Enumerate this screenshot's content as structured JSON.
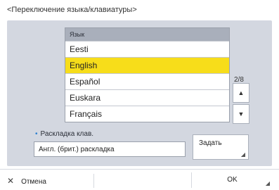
{
  "title": "<Переключение языка/клавиатуры>",
  "language_list": {
    "header": "Язык",
    "items": [
      {
        "label": "Eesti",
        "selected": false
      },
      {
        "label": "English",
        "selected": true
      },
      {
        "label": "Español",
        "selected": false
      },
      {
        "label": "Euskara",
        "selected": false
      },
      {
        "label": "Français",
        "selected": false
      }
    ]
  },
  "pagination": {
    "indicator": "2/8",
    "up_icon": "triangle-up-icon",
    "down_icon": "triangle-down-icon"
  },
  "keyboard_layout": {
    "label": "Раскладка клав.",
    "value": "Англ. (брит.) раскладка",
    "set_label": "Задать"
  },
  "footer": {
    "cancel_label": "Отмена",
    "ok_label": "OK"
  },
  "colors": {
    "selection": "#f7dd1a",
    "panel": "#d3d7e0",
    "accent": "#2a7fd1"
  }
}
